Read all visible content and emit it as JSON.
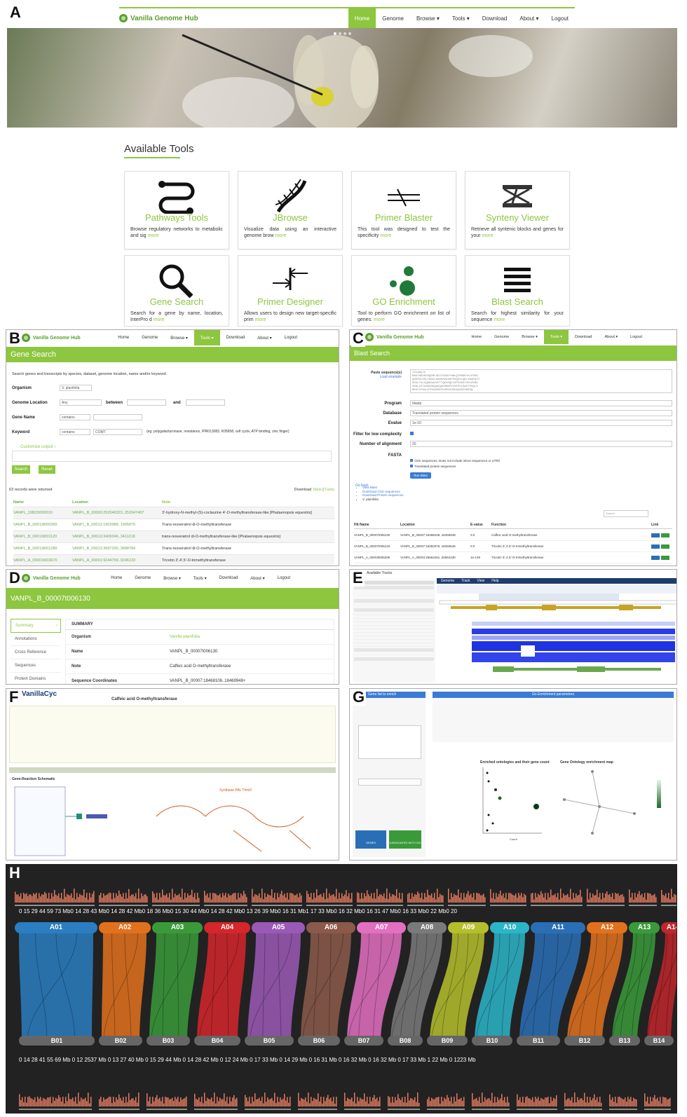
{
  "panel_labels": {
    "a": "A",
    "b": "B",
    "c": "C",
    "d": "D",
    "e": "E",
    "f": "F",
    "g": "G",
    "h": "H"
  },
  "nav": {
    "brand": "Vanilla Genome Hub",
    "items": [
      "Home",
      "Genome",
      "Browse ▾",
      "Tools ▾",
      "Download",
      "About ▾",
      "Logout"
    ]
  },
  "panel_a": {
    "section_title": "Available Tools",
    "tools": [
      {
        "title": "Pathways Tools",
        "desc": "Browse regulatory networks to metabolic and sig",
        "more": "more",
        "icon": "pathways-icon"
      },
      {
        "title": "JBrowse",
        "desc": "Visualize data using an interactive genome brow",
        "more": "more",
        "icon": "dna-icon"
      },
      {
        "title": "Primer Blaster",
        "desc": "This tool was designed to test the specificity",
        "more": "more",
        "icon": "primer-blaster-icon"
      },
      {
        "title": "Synteny Viewer",
        "desc": "Retrieve all syntenic blocks and genes for your",
        "more": "more",
        "icon": "synteny-icon"
      },
      {
        "title": "Gene Search",
        "desc": "Search for a gene by name, location, InterPro d",
        "more": "more",
        "icon": "magnifier-icon"
      },
      {
        "title": "Primer Designer",
        "desc": "Allows users to design new target-specific prim",
        "more": "more",
        "icon": "primer-designer-icon"
      },
      {
        "title": "GO Enrichment",
        "desc": "Tool to perform GO enrichment on list of genes.",
        "more": "more",
        "icon": "go-enrichment-icon"
      },
      {
        "title": "Blast Search",
        "desc": "Search for highest similarity for your sequence",
        "more": "more",
        "icon": "list-icon"
      }
    ]
  },
  "panel_b": {
    "header": "Gene Search",
    "intro": "Search genes and transcripts by species, dataset, genome location, name and/or keyword.",
    "organism_label": "Organism",
    "organism_value": "V. planifolia",
    "location_label": "Genome Location",
    "location_value": "Any",
    "between": "between",
    "and": "and",
    "gene_name_label": "Gene Name",
    "gene_name_op": "contains",
    "keyword_label": "Keyword",
    "keyword_op": "contains",
    "keyword_value": "COMT",
    "keyword_hint": "(eg. polygalacturonase, resistance, IPR013083, K05658, cell cycle, ATP binding, zinc finger)",
    "customize": "Customize output",
    "search_btn": "Search",
    "reset_btn": "Reset",
    "records": "63 records were returned",
    "download": "Download",
    "table": "Table",
    "fasta": "Fasta",
    "columns": [
      "Name",
      "Location",
      "Note"
    ],
    "rows": [
      [
        "VANPL_19822t000010",
        "VANPL_B_00000:252046323..252047487",
        "3'-hydroxy-N-methyl-(S)-coclaurine 4'-O-methyltransferase-like [Phalaenopsis equestris]"
      ],
      [
        "VANPL_B_00013t000360",
        "VANPL_B_00013:1903988..1905876",
        "Trans-resveratrol di-O-methyltransferase"
      ],
      [
        "VANPL_B_00013t001120",
        "VANPL_B_00013:3409346..3411218",
        "trans-resveratrol di-O-methyltransferase-like [Phalaenopsis equestris]"
      ],
      [
        "VANPL_B_00013t001280",
        "VANPL_B_00013:3687290..3688784",
        "Trans-resveratrol di-O-methyltransferase"
      ],
      [
        "VANPL_A_00001t003670",
        "VANPL_A_00001:9244799..9246133",
        "Tricetin 3',4',5'-O-trimethyltransferase"
      ]
    ]
  },
  "panel_c": {
    "header": "Blast Search",
    "paste_label": "Paste sequence(s)",
    "load_example": "Load example",
    "program_label": "Program",
    "program_value": "blastp",
    "database_label": "Database",
    "database_value": "Translated protein sequences",
    "evalue_label": "Evalue",
    "evalue_value": "1e-10",
    "filter_label": "Filter for low complexity",
    "align_label": "Number of alignment",
    "align_value": "20",
    "fasta_label": "FASTA",
    "cds_opt": "CDS sequences. Does not include intron sequences or UTRs",
    "prot_opt": "Translated protein sequences",
    "run_btn": "Run Blast",
    "go_back": "Go back",
    "links": [
      "View Blast",
      "Download CDS sequences",
      "Download Protein sequences",
      "V. planifolia"
    ],
    "search_placeholder": "Search",
    "columns": [
      "Hit Name",
      "Location",
      "E-value",
      "Function",
      "Link"
    ],
    "rows": [
      [
        "VANPL_B_00007t006130",
        "VANPL_B_00007:18468106..18469948",
        "0.0",
        "Caffeic acid O-methyltransferase"
      ],
      [
        "VANPL_B_00007t006140",
        "VANPL_B_00007:18483376..18493546",
        "0.0",
        "Tricetin 3',4',5'-O-trimethyltransferase"
      ],
      [
        "VANPL_A_00003t006290",
        "VANPL_A_00003:25562261..25564430",
        "1e-149",
        "Tricetin 3',4',5'-O-trimethyltransferase"
      ]
    ]
  },
  "panel_d": {
    "header": "VANPL_B_00007t006130",
    "side": [
      "Summary",
      "Annotations",
      "Cross Reference",
      "Sequences",
      "Protein Domains"
    ],
    "summary_title": "SUMMARY",
    "fields": [
      [
        "Organism",
        "Vanilla planifolia"
      ],
      [
        "Name",
        "VANPL_B_00007t006130"
      ],
      [
        "Note",
        "Caffeic acid O-methyltransferase"
      ],
      [
        "Sequence Coordinates",
        "VANPL_B_00007:18468106..18469948+"
      ]
    ]
  },
  "panel_e": {
    "menus": [
      "Genome",
      "Track",
      "View",
      "Help"
    ],
    "title": "Available Tracks"
  },
  "panel_f": {
    "brand": "VanillaCyc",
    "title": "Caffeic acid O-methyltransferase",
    "schematic": "Gene-Reaction Schematic"
  },
  "panel_g": {
    "left_title": "Gene list to enrich",
    "right_title": "Go Enrichment parameters",
    "chart_title": "Enriched ontologies and their gene count",
    "map_title": "Gene Ontology enrichment map",
    "btn1": "GENES",
    "btn2": "ASSOCIATED WITH GO",
    "x_axis": "Count"
  },
  "panel_h": {
    "top_chromosomes": [
      "A01",
      "A02",
      "A03",
      "A04",
      "A05",
      "A06",
      "A07",
      "A08",
      "A09",
      "A10",
      "A11",
      "A12",
      "A13",
      "A14"
    ],
    "bottom_chromosomes": [
      "B01",
      "B02",
      "B03",
      "B04",
      "B05",
      "B06",
      "B07",
      "B08",
      "B09",
      "B10",
      "B11",
      "B12",
      "B13",
      "B14"
    ],
    "colors": [
      "#2a7ec1",
      "#e2711d",
      "#3a9a3a",
      "#d4262b",
      "#9b59b6",
      "#8b5a4a",
      "#e36fc1",
      "#7a7a7a",
      "#b5bf2b",
      "#2bb5c9",
      "#2a6fb5",
      "#e2711d",
      "#3a9a3a",
      "#c0262b"
    ],
    "top_ticks": "0   15   29   44   59   73 Mb0   14   28   43 Mb0   14   28   42 Mb0   18   36 Mb0   15   30   44 Mb0   14   28   42 Mb0   13   26 39 Mb0   16   31 Mb1   17   33 Mb0   16   32 Mb0   16   31   47 Mb0   16   33 Mb0   22 Mb0   20",
    "bottom_ticks": "0   14   28   41   55 69 Mb 0   12   2537 Mb 0   13   27 40 Mb 0   15   29   44 Mb 0   14   28   42 Mb 0   12 24 Mb 0   17   33 Mb 0   14   29 Mb 0   16   31 Mb 0   16   32 Mb 0   16   32 Mb 0   17   33 Mb 1   22 Mb 0   1223 Mb"
  }
}
